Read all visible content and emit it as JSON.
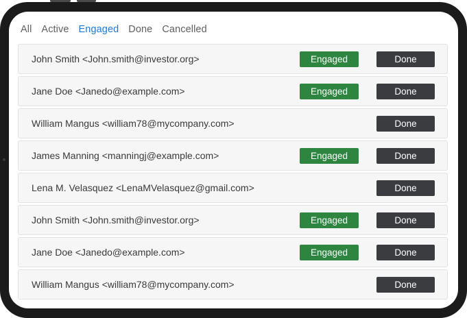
{
  "tabs": [
    {
      "label": "All",
      "active": false
    },
    {
      "label": "Active",
      "active": false
    },
    {
      "label": "Engaged",
      "active": true
    },
    {
      "label": "Done",
      "active": false
    },
    {
      "label": "Cancelled",
      "active": false
    }
  ],
  "rows": [
    {
      "text": "John Smith <John.smith@investor.org>",
      "engaged_label": "Engaged",
      "done_label": "Done"
    },
    {
      "text": "Jane Doe <Janedo@example.com>",
      "engaged_label": "Engaged",
      "done_label": "Done"
    },
    {
      "text": "William Mangus <william78@mycompany.com>",
      "engaged_label": null,
      "done_label": "Done"
    },
    {
      "text": "James Manning <manningj@example.com>",
      "engaged_label": "Engaged",
      "done_label": "Done"
    },
    {
      "text": "Lena M. Velasquez <LenaMVelasquez@gmail.com>",
      "engaged_label": null,
      "done_label": "Done"
    },
    {
      "text": "John Smith <John.smith@investor.org>",
      "engaged_label": "Engaged",
      "done_label": "Done"
    },
    {
      "text": "Jane Doe <Janedo@example.com>",
      "engaged_label": "Engaged",
      "done_label": "Done"
    },
    {
      "text": "William Mangus <william78@mycompany.com>",
      "engaged_label": null,
      "done_label": "Done"
    }
  ],
  "colors": {
    "active_tab": "#1e78d6",
    "engaged_button": "#2e8540",
    "done_button": "#3a3c40",
    "device_frame": "#1b1b1b"
  }
}
